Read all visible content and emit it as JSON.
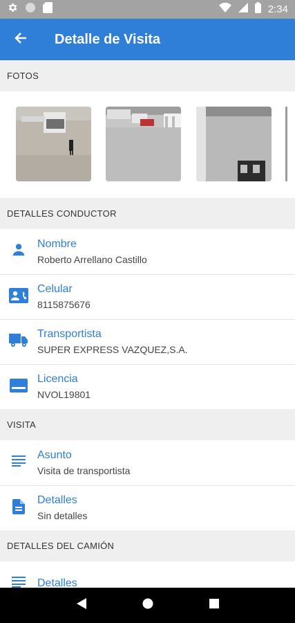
{
  "status_bar": {
    "time": "2:34"
  },
  "app_bar": {
    "title": "Detalle de Visita"
  },
  "sections": {
    "photos": {
      "header": "FOTOS"
    },
    "driver": {
      "header": "DETALLES CONDUCTOR",
      "items": [
        {
          "label": "Nombre",
          "value": "Roberto Arrellano Castillo",
          "icon": "person-icon"
        },
        {
          "label": "Celular",
          "value": "8115875676",
          "icon": "contact-card-icon"
        },
        {
          "label": "Transportista",
          "value": "SUPER EXPRESS VAZQUEZ,S.A.",
          "icon": "truck-icon"
        },
        {
          "label": "Licencia",
          "value": "NVOL19801",
          "icon": "card-icon"
        }
      ]
    },
    "visit": {
      "header": "VISITA",
      "items": [
        {
          "label": "Asunto",
          "value": "Visita de transportista",
          "icon": "subject-icon"
        },
        {
          "label": "Detalles",
          "value": "Sin detalles",
          "icon": "document-icon"
        }
      ]
    },
    "truck": {
      "header": "DETALLES DEL CAMIÓN",
      "items": [
        {
          "label": "Detalles",
          "value": "",
          "icon": "subject-icon"
        }
      ]
    }
  },
  "colors": {
    "primary": "#2f7ed8",
    "status_bar": "#a3a3a3",
    "nav_bar": "#000000"
  }
}
